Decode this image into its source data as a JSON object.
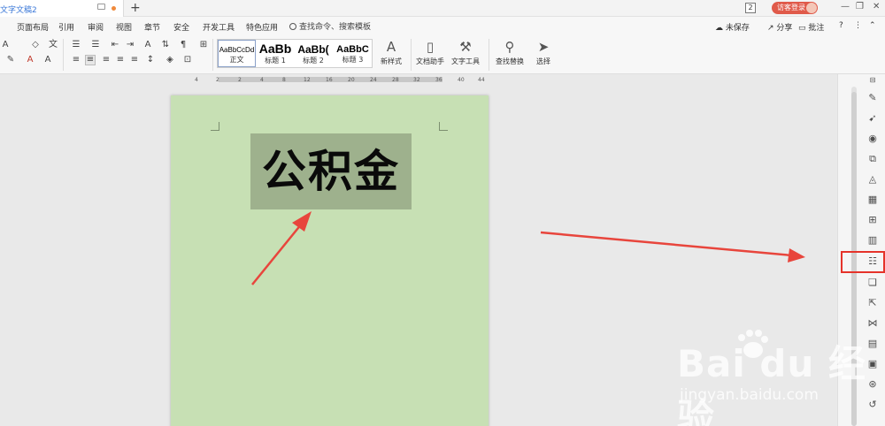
{
  "tab": {
    "title": "文字文稿2",
    "new_tab_label": "+",
    "count": "2",
    "login_label": "访客登录"
  },
  "menu": {
    "items": [
      "页面布局",
      "引用",
      "审阅",
      "视图",
      "章节",
      "安全",
      "开发工具",
      "特色应用"
    ],
    "search_placeholder": "查找命令、搜索模板",
    "unsaved": "未保存",
    "share": "分享",
    "comment": "批注",
    "help": "?"
  },
  "ribbon": {
    "styles": [
      {
        "preview": "AaBbCcDd",
        "name": "正文"
      },
      {
        "preview": "AaBb",
        "name": "标题 1"
      },
      {
        "preview": "AaBb(",
        "name": "标题 2"
      },
      {
        "preview": "AaBbC",
        "name": "标题 3"
      }
    ],
    "new_style": "新样式",
    "doc_assistant": "文档助手",
    "text_tools": "文字工具",
    "find_replace": "查找替换",
    "select": "选择"
  },
  "ruler": {
    "ticks": [
      "4",
      "2",
      "2",
      "4",
      "8",
      "12",
      "16",
      "20",
      "24",
      "28",
      "32",
      "36",
      "40",
      "44"
    ]
  },
  "document": {
    "title_text": "公积金",
    "title_bg": "#9eb18d",
    "page_bg": "#c7e0b4"
  },
  "sidebar": {
    "icons": [
      "pen-icon",
      "cursor-icon",
      "location-icon",
      "shapes-icon",
      "paint-bucket-icon",
      "table-icon",
      "apps-icon",
      "chart-icon",
      "settings-sliders-icon",
      "copy-file-icon",
      "export-icon",
      "share-nodes-icon",
      "layout-icon",
      "image-icon",
      "compass-icon",
      "history-icon"
    ],
    "highlighted": "settings-sliders-icon"
  },
  "watermark": {
    "logo": "Bai du 经验",
    "url": "jingyan.baidu.com"
  },
  "colors": {
    "accent_red": "#e5332a",
    "arrow_red": "#e8453c",
    "tab_blue": "#3b78d8"
  }
}
